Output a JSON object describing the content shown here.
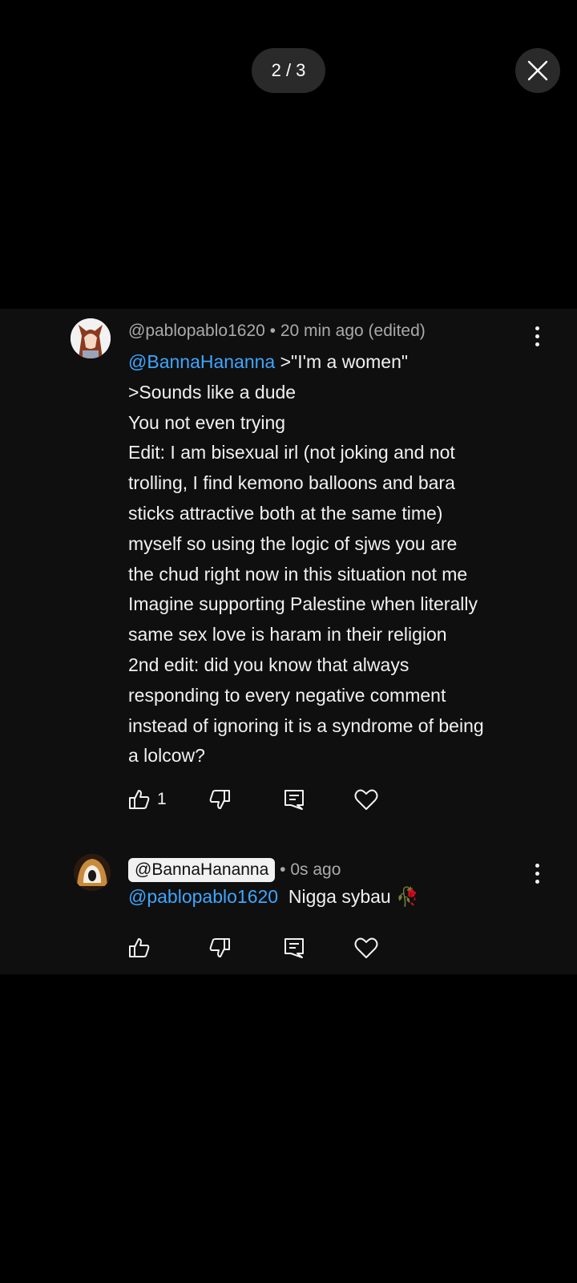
{
  "viewer": {
    "counter": "2 / 3"
  },
  "comments": [
    {
      "author_meta": "@pablopablo1620 • 20 min ago (edited)",
      "mention": "@BannaHananna",
      "first_line_rest": " >\"I'm a women\"",
      "lines": [
        ">Sounds like a dude",
        "You not even trying",
        "Edit: I am bisexual irl (not joking and not",
        "trolling, I find kemono balloons and bara",
        "sticks attractive both at the same time)",
        "myself so using the logic of sjws you are",
        "the chud right now in this situation not me",
        "Imagine supporting Palestine when literally",
        "same sex love is haram in their religion",
        "2nd edit: did you know that always",
        "responding to every negative comment",
        "instead of ignoring it is a syndrome of being",
        "a lolcow?"
      ],
      "like_count": "1"
    },
    {
      "author": "@BannaHananna",
      "time": " • 0s ago",
      "mention": "@pablopablo1620",
      "text": "  Nigga sybau 🥀"
    }
  ],
  "icons": [
    "close-icon",
    "more-vert-icon",
    "thumb-up-icon",
    "thumb-down-icon",
    "reply-icon",
    "heart-icon"
  ]
}
